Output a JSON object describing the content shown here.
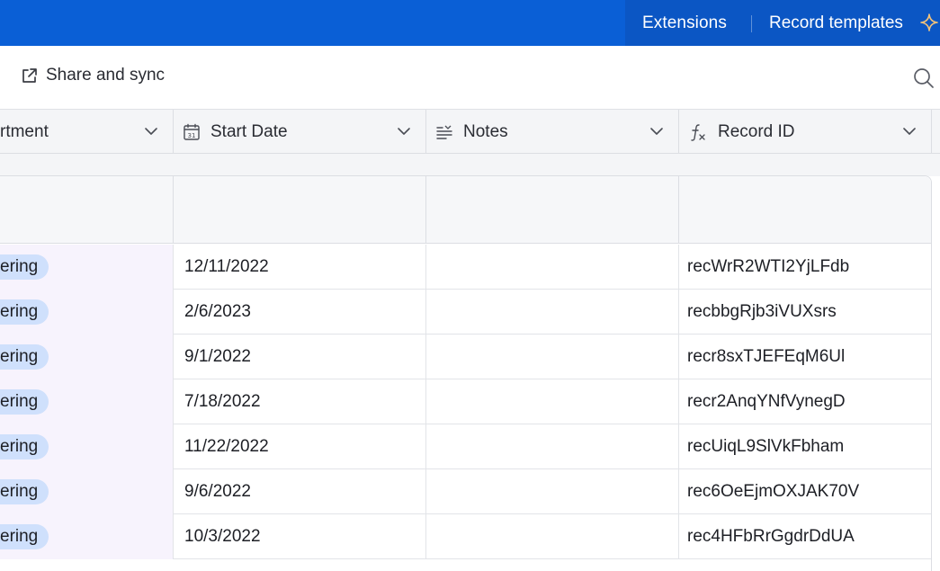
{
  "topbar": {
    "extensions_label": "Extensions",
    "record_templates_label": "Record templates"
  },
  "toolbar": {
    "share_label": "Share and sync"
  },
  "columns": [
    {
      "label": "rtment",
      "icon": "none"
    },
    {
      "label": "Start Date",
      "icon": "calendar-icon"
    },
    {
      "label": "Notes",
      "icon": "long-text-icon"
    },
    {
      "label": "Record ID",
      "icon": "formula-icon"
    }
  ],
  "rows": [
    {
      "department": "ering",
      "start_date": "12/11/2022",
      "notes": "",
      "record_id": "recWrR2WTI2YjLFdb"
    },
    {
      "department": "ering",
      "start_date": "2/6/2023",
      "notes": "",
      "record_id": "recbbgRjb3iVUXsrs"
    },
    {
      "department": "ering",
      "start_date": "9/1/2022",
      "notes": "",
      "record_id": "recr8sxTJEFEqM6Ul"
    },
    {
      "department": "ering",
      "start_date": "7/18/2022",
      "notes": "",
      "record_id": "recr2AnqYNfVynegD"
    },
    {
      "department": "ering",
      "start_date": "11/22/2022",
      "notes": "",
      "record_id": "recUiqL9SlVkFbham"
    },
    {
      "department": "ering",
      "start_date": "9/6/2022",
      "notes": "",
      "record_id": "rec6OeEjmOXJAK70V"
    },
    {
      "department": "ering",
      "start_date": "10/3/2022",
      "notes": "",
      "record_id": "rec4HFbRrGgdrDdUA"
    }
  ],
  "colors": {
    "topbar": "#0a5fd6",
    "pill": "#cfe0fc",
    "department_cell": "#f7f3fd"
  }
}
